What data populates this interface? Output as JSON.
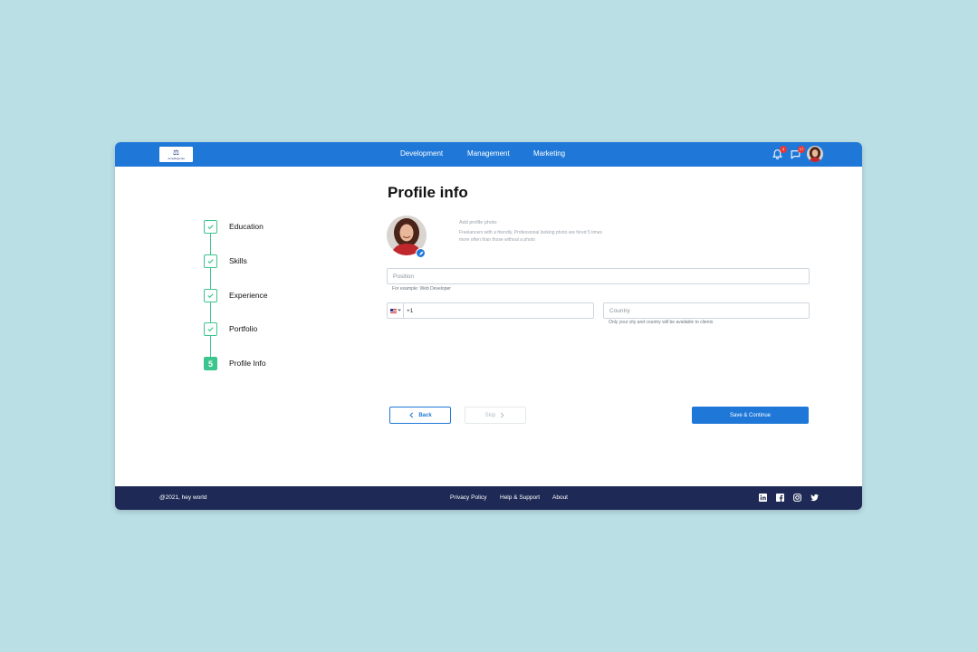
{
  "header": {
    "logo_mark": "⚖",
    "logo_text": "AuraMagnolia",
    "nav": [
      "Development",
      "Management",
      "Marketing"
    ],
    "notifications_count": "4",
    "messages_count": "17"
  },
  "stepper": {
    "steps": [
      {
        "label": "Education",
        "status": "done"
      },
      {
        "label": "Skills",
        "status": "done"
      },
      {
        "label": "Experience",
        "status": "done"
      },
      {
        "label": "Portfolio",
        "status": "done"
      },
      {
        "label": "Profile Info",
        "status": "active",
        "number": "5"
      }
    ]
  },
  "main": {
    "title": "Profile info",
    "photo": {
      "add_label": "Add profile photo",
      "hint": "Freelancers with a friendly, Professional looking photo are hired 5 times more often than those without a photo"
    },
    "position": {
      "placeholder": "Position",
      "helper": "For example: Web Developer"
    },
    "phone": {
      "country_code": "+1",
      "flag": "US"
    },
    "country": {
      "placeholder": "Country",
      "helper": "Only your city and country will be available to clients"
    },
    "buttons": {
      "back": "Back",
      "skip": "Skip",
      "save": "Save & Continue"
    }
  },
  "footer": {
    "copyright": "@2021, hey world",
    "links": [
      "Privacy Policy",
      "Help & Support",
      "About"
    ],
    "social": [
      "linkedin-icon",
      "facebook-icon",
      "instagram-icon",
      "twitter-icon"
    ]
  },
  "colors": {
    "primary": "#1f78d8",
    "step_green": "#3cc58e",
    "footer_bg": "#1e2a55",
    "page_bg": "#badfe5"
  }
}
